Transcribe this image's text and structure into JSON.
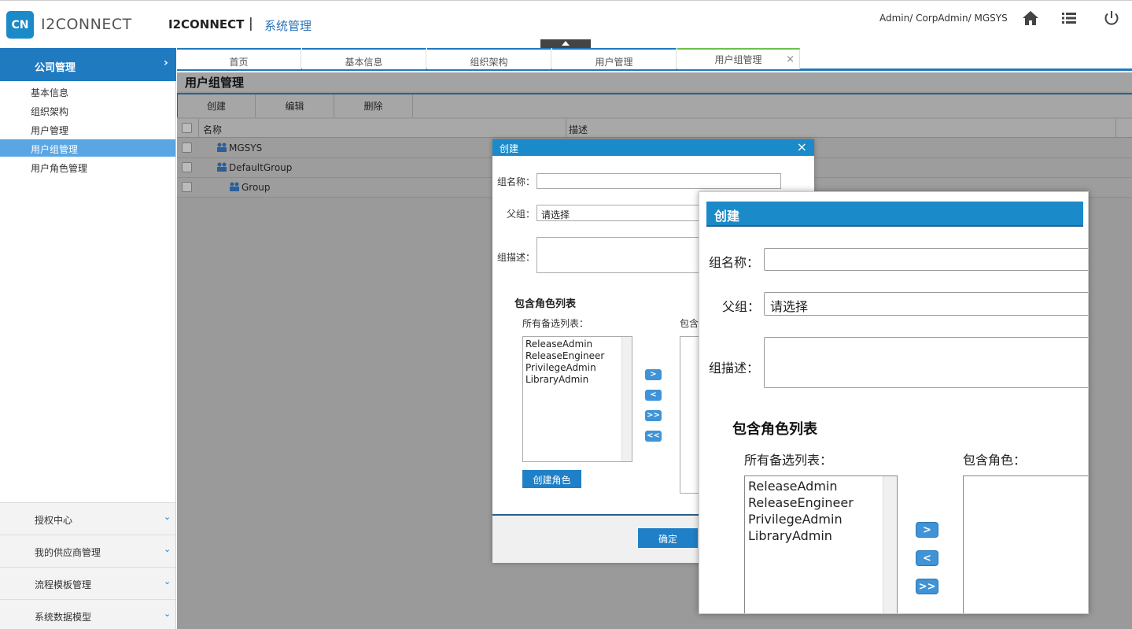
{
  "header": {
    "logo_mark": "CN",
    "logo_text": "I2CONNECT",
    "app_title": "I2CONNECT",
    "separator": "|",
    "app_subtitle": "系统管理",
    "user_info": "Admin/ CorpAdmin/ MGSYS"
  },
  "sidebar": {
    "active_section": "公司管理",
    "active_arrow": "›",
    "items": [
      "基本信息",
      "组织架构",
      "用户管理",
      "用户组管理",
      "用户角色管理"
    ],
    "menus": [
      "授权中心",
      "我的供应商管理",
      "流程模板管理",
      "系统数据模型"
    ]
  },
  "tabs": [
    "首页",
    "基本信息",
    "组织架构",
    "用户管理",
    "用户组管理"
  ],
  "main": {
    "page_title": "用户组管理",
    "toolbar": [
      "创建",
      "编辑",
      "删除"
    ],
    "columns": [
      "名称",
      "描述"
    ],
    "rows": [
      "MGSYS",
      "DefaultGroup",
      "Group"
    ]
  },
  "dialog": {
    "title": "创建",
    "group_name_label": "组名称：",
    "parent_label": "父组：",
    "parent_value": "请选择",
    "desc_label": "组描述：",
    "section_title": "包含角色列表",
    "available_label": "所有备选列表：",
    "included_label": "包含",
    "available_roles": [
      "ReleaseAdmin",
      "ReleaseEngineer",
      "PrivilegeAdmin",
      "LibraryAdmin"
    ],
    "arrows": [
      ">",
      "<",
      ">>",
      "<<"
    ],
    "create_role_button": "创建角色",
    "ok_button": "确定"
  },
  "zoom": {
    "title": "创建",
    "group_name_label": "组名称：",
    "parent_label": "父组：",
    "parent_value": "请选择",
    "desc_label": "组描述：",
    "section_title": "包含角色列表",
    "available_label": "所有备选列表：",
    "included_label": "包含角色：",
    "available_roles": [
      "ReleaseAdmin",
      "ReleaseEngineer",
      "PrivilegeAdmin",
      "LibraryAdmin"
    ],
    "arrows": [
      ">",
      "<",
      ">>"
    ]
  }
}
